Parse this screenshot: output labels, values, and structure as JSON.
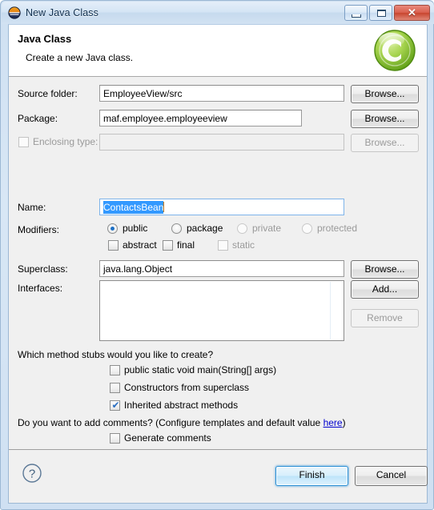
{
  "window": {
    "title": "New Java Class",
    "icon": "eclipse-icon",
    "controls": {
      "minimize": "Minimize",
      "maximize": "Maximize",
      "close": "Close",
      "close_glyph": "✕"
    }
  },
  "header": {
    "title": "Java Class",
    "description": "Create a new Java class.",
    "logo": "java-class-wizard-icon",
    "logo_letter": "C"
  },
  "form": {
    "source_folder": {
      "label": "Source folder:",
      "value": "EmployeeView/src",
      "browse": "Browse..."
    },
    "package": {
      "label": "Package:",
      "value": "maf.employee.employeeview",
      "browse": "Browse..."
    },
    "enclosing_type": {
      "label": "Enclosing type:",
      "checked": false,
      "value": "",
      "browse": "Browse...",
      "enabled": false
    },
    "name": {
      "label": "Name:",
      "value": "ContactsBean",
      "selected": true
    },
    "modifiers": {
      "label": "Modifiers:",
      "access": [
        {
          "label": "public",
          "selected": true,
          "enabled": true
        },
        {
          "label": "package",
          "selected": false,
          "enabled": true
        },
        {
          "label": "private",
          "selected": false,
          "enabled": false
        },
        {
          "label": "protected",
          "selected": false,
          "enabled": false
        }
      ],
      "flags": [
        {
          "label": "abstract",
          "checked": false,
          "enabled": true
        },
        {
          "label": "final",
          "checked": false,
          "enabled": true
        },
        {
          "label": "static",
          "checked": false,
          "enabled": false
        }
      ]
    },
    "superclass": {
      "label": "Superclass:",
      "value": "java.lang.Object",
      "browse": "Browse..."
    },
    "interfaces": {
      "label": "Interfaces:",
      "items": [],
      "add": "Add...",
      "remove": "Remove"
    }
  },
  "stubs": {
    "question": "Which method stubs would you like to create?",
    "options": [
      {
        "label": "public static void main(String[] args)",
        "checked": false
      },
      {
        "label": "Constructors from superclass",
        "checked": false
      },
      {
        "label": "Inherited abstract methods",
        "checked": true
      }
    ]
  },
  "comments": {
    "question_prefix": "Do you want to add comments? (Configure templates and default value ",
    "link": "here",
    "question_suffix": ")",
    "option": {
      "label": "Generate comments",
      "checked": false
    }
  },
  "footer": {
    "help": "?",
    "finish": "Finish",
    "cancel": "Cancel"
  },
  "colors": {
    "selection_blue": "#3399ff",
    "link_blue": "#0000cf",
    "default_button_border": "#2a8fd4",
    "logo_green": "#8dc63f",
    "title_bar": "#d5e5f5"
  }
}
